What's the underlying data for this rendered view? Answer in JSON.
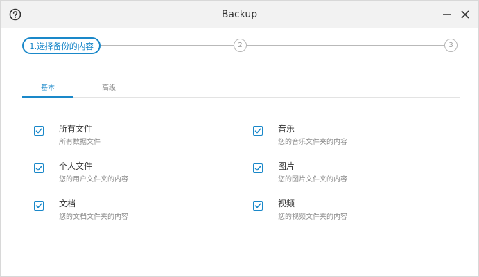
{
  "window": {
    "title": "Backup"
  },
  "stepper": {
    "active_label": "1.选择备份的内容",
    "step2": "2",
    "step3": "3"
  },
  "tabs": [
    {
      "label": "基本",
      "active": true
    },
    {
      "label": "高级",
      "active": false
    }
  ],
  "options": [
    {
      "title": "所有文件",
      "desc": "所有数据文件",
      "checked": true
    },
    {
      "title": "音乐",
      "desc": "您的音乐文件夹的内容",
      "checked": true
    },
    {
      "title": "个人文件",
      "desc": "您的用户文件夹的内容",
      "checked": true
    },
    {
      "title": "图片",
      "desc": "您的图片文件夹的内容",
      "checked": true
    },
    {
      "title": "文档",
      "desc": "您的文档文件夹的内容",
      "checked": true
    },
    {
      "title": "视频",
      "desc": "您的视频文件夹的内容",
      "checked": true
    }
  ],
  "icons": {
    "help": "help-icon",
    "minimize": "minimize-icon",
    "close": "close-icon",
    "check": "checkmark-icon"
  },
  "colors": {
    "accent": "#1a88c9",
    "titlebar": "#f2f2f2",
    "muted_text": "#8c8c8c"
  }
}
